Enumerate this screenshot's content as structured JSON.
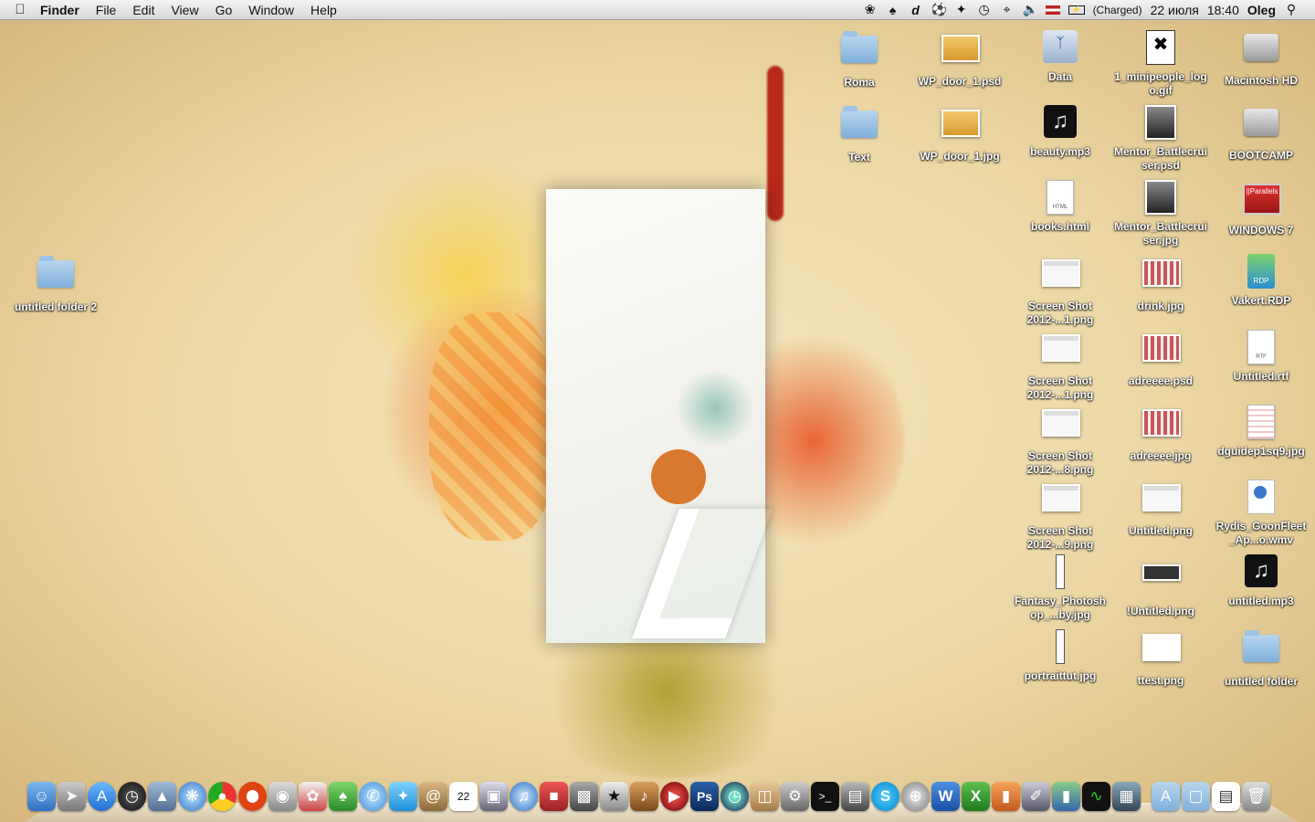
{
  "menubar": {
    "app": "Finder",
    "menus": [
      "File",
      "Edit",
      "View",
      "Go",
      "Window",
      "Help"
    ],
    "status": {
      "battery_text": "(Charged)",
      "date": "22 июля",
      "time": "18:40",
      "user": "Oleg"
    }
  },
  "desktop_icons": {
    "untitled_folder_2": "untitled folder 2",
    "roma": "Roma",
    "text": "Text",
    "wp_door_psd": "WP_door_1.psd",
    "wp_door_jpg": "WP_door_1.jpg",
    "data": "Data",
    "beauty": "beauty.mp3",
    "books": "books.html",
    "ss1": "Screen Shot 2012-...1.png",
    "ss2": "Screen Shot 2012-...1.png",
    "ss3": "Screen Shot 2012-...8.png",
    "ss4": "Screen Shot 2012-...9.png",
    "fantasy": "Fantasy_Photoshop_...by.jpg",
    "portrait": "portraittut.jpg",
    "minipeople": "1_minipeople_logo.gif",
    "mentor_psd": "Mentor_Battlecruiser.psd",
    "mentor_jpg": "Mentor_Battlecruiser.jpg",
    "drink": "drink.jpg",
    "adreeee_psd": "adreeee.psd",
    "adreeee_jpg": "adreeee.jpg",
    "untitled_png": "Untitled.png",
    "iuntitled_png": "!Untitled.png",
    "ttest": "ttest.png",
    "macintosh": "Macintosh HD",
    "bootcamp": "BOOTCAMP",
    "windows7": "WINDOWS 7",
    "vakert": "Vakert.RDP",
    "untitled_rtf": "Untitled.rtf",
    "dguide": "dguidep1sq9.jpg",
    "rydis": "Rydis_GoonFleet_Ap...o.wmv",
    "untitled_mp3": "untitled.mp3",
    "untitled_folder": "untitled folder"
  },
  "icon_glyphs": {
    "html_tag": "HTML",
    "rtf_tag": "RTF",
    "rdp_tag": "RDP",
    "parallels_tag": "||Parallels",
    "ps": "Ps",
    "word": "W",
    "excel": "X",
    "calendar_day": "22"
  },
  "colors": {
    "label_text": "#ffffff",
    "folder_blue": "#8fbbe3",
    "wallpaper": "#ecd7a5"
  }
}
